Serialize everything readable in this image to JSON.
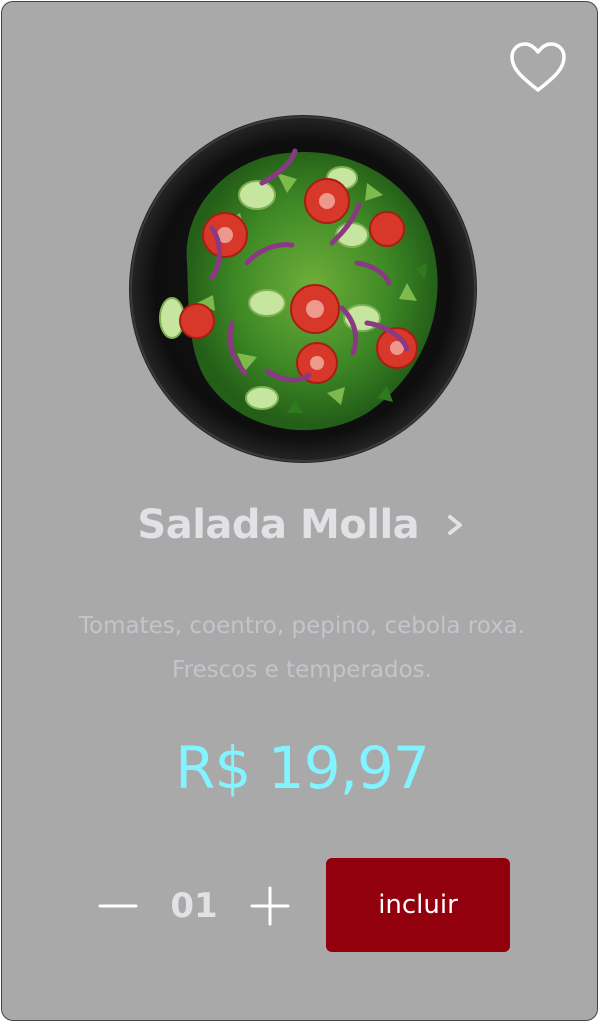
{
  "product": {
    "name": "Salada Molla",
    "description": "Tomates, coentro, pepino, cebola roxa. Frescos e temperados.",
    "price": "R$ 19,97",
    "image_alt": "Salada Molla"
  },
  "order": {
    "quantity": "01",
    "add_label": "incluir"
  },
  "icons": {
    "favorite": "heart-icon",
    "details": "chevron-right-icon",
    "decrease": "minus-icon",
    "increase": "plus-icon"
  },
  "colors": {
    "card_bg": "#a9a9a9",
    "title": "#e1e1e6",
    "description": "#c4c4cc",
    "price": "#82f3ff",
    "button_bg": "#92000e",
    "button_text": "#ffffff"
  }
}
